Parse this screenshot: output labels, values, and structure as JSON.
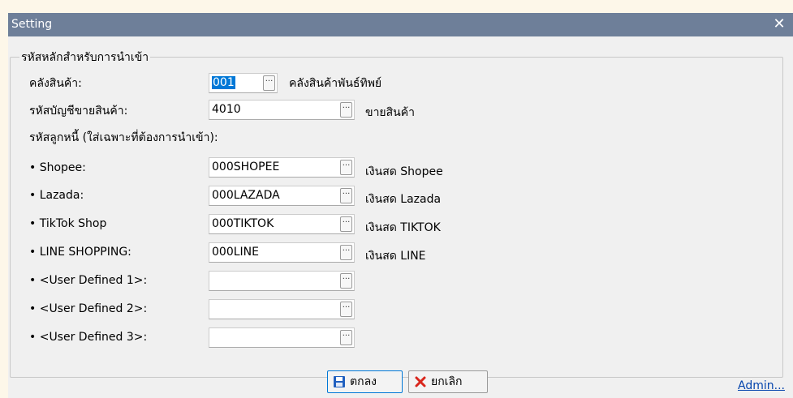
{
  "window": {
    "title": "Setting",
    "close_glyph": "✕"
  },
  "group": {
    "legend": "รหัสหลักสำหรับการนำเข้า"
  },
  "warehouse": {
    "label": "คลังสินค้า:",
    "value": "001",
    "browse": "···",
    "description": "คลังสินค้าพันธ์ทิพย์"
  },
  "sales_account": {
    "label": "รหัสบัญชีขายสินค้า:",
    "value": "4010",
    "browse": "···",
    "description": "ขายสินค้า"
  },
  "debtor_section": {
    "label": "รหัสลูกหนี้ (ใส่เฉพาะที่ต้องการนำเข้า):"
  },
  "debtors": [
    {
      "label": "• Shopee:",
      "value": "000SHOPEE",
      "browse": "···",
      "description": "เงินสด Shopee"
    },
    {
      "label": "• Lazada:",
      "value": "000LAZADA",
      "browse": "···",
      "description": "เงินสด Lazada"
    },
    {
      "label": "• TikTok Shop",
      "value": "000TIKTOK",
      "browse": "···",
      "description": "เงินสด TIKTOK"
    },
    {
      "label": "• LINE SHOPPING:",
      "value": "000LINE",
      "browse": "···",
      "description": "เงินสด LINE"
    },
    {
      "label": "• <User Defined 1>:",
      "value": "",
      "browse": "···",
      "description": ""
    },
    {
      "label": "• <User Defined 2>:",
      "value": "",
      "browse": "···",
      "description": ""
    },
    {
      "label": "• <User Defined 3>:",
      "value": "",
      "browse": "···",
      "description": ""
    }
  ],
  "buttons": {
    "ok_label": "ตกลง",
    "cancel_label": "ยกเลิก",
    "ok_icon": "save-icon",
    "cancel_icon": "x-icon",
    "ok_icon_color": "#1f5fbf",
    "cancel_icon_color": "#d9261c"
  },
  "admin_link": "Admin...",
  "colors": {
    "titlebar": "#6e7f99",
    "dialog_bg": "#f0f0f0",
    "selection": "#0078d7",
    "link": "#0645ad"
  }
}
